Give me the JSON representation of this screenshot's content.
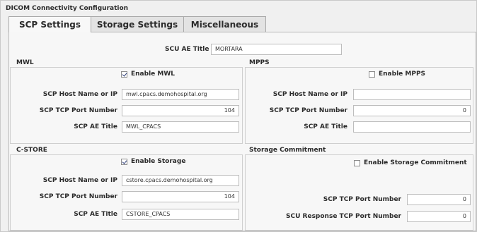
{
  "window": {
    "title": "DICOM Connectivity Configuration"
  },
  "tabs": [
    {
      "label": "SCP Settings",
      "active": true
    },
    {
      "label": "Storage Settings",
      "active": false
    },
    {
      "label": "Miscellaneous",
      "active": false
    }
  ],
  "scu": {
    "label": "SCU AE Title",
    "value": "MORTARA"
  },
  "mwl": {
    "title": "MWL",
    "enable_label": "Enable MWL",
    "enabled": true,
    "host_label": "SCP Host Name or IP",
    "host_value": "mwl.cpacs.demohospital.org",
    "port_label": "SCP TCP Port Number",
    "port_value": "104",
    "ae_label": "SCP AE Title",
    "ae_value": "MWL_CPACS"
  },
  "mpps": {
    "title": "MPPS",
    "enable_label": "Enable MPPS",
    "enabled": false,
    "host_label": "SCP Host Name or IP",
    "host_value": "",
    "port_label": "SCP TCP Port Number",
    "port_value": "0",
    "ae_label": "SCP AE Title",
    "ae_value": ""
  },
  "cstore": {
    "title": "C-STORE",
    "enable_label": "Enable Storage",
    "enabled": true,
    "host_label": "SCP Host Name or IP",
    "host_value": "cstore.cpacs.demohospital.org",
    "port_label": "SCP TCP Port Number",
    "port_value": "104",
    "ae_label": "SCP AE Title",
    "ae_value": "CSTORE_CPACS"
  },
  "commit": {
    "title": "Storage Commitment",
    "enable_label": "Enable Storage Commitment",
    "enabled": false,
    "port_label": "SCP TCP Port Number",
    "port_value": "0",
    "resp_label": "SCU Response TCP Port Number",
    "resp_value": "0"
  }
}
